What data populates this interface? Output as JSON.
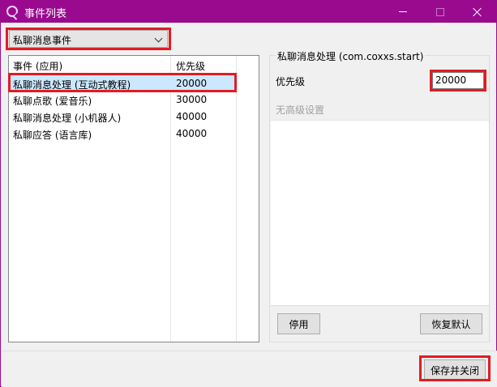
{
  "window": {
    "title": "事件列表",
    "accent": "#9a0a8f"
  },
  "event_select": {
    "value": "私聊消息事件"
  },
  "list": {
    "headers": [
      "事件 (应用)",
      "优先级"
    ],
    "rows": [
      {
        "name": "私聊消息处理 (互动式教程)",
        "priority": "20000"
      },
      {
        "name": "私聊点歌 (爱音乐)",
        "priority": "30000"
      },
      {
        "name": "私聊消息处理 (小机器人)",
        "priority": "40000"
      },
      {
        "name": "私聊应答 (语言库)",
        "priority": "40000"
      }
    ]
  },
  "detail": {
    "title": "私聊消息处理 (com.coxxs.start)",
    "priority_label": "优先级",
    "priority_value": "20000",
    "no_advanced": "无高级设置",
    "disable_button": "停用",
    "restore_button": "恢复默认"
  },
  "footer": {
    "save_close_button": "保存并关闭"
  }
}
